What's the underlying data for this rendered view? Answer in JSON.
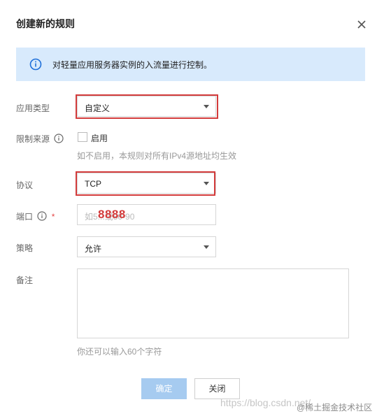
{
  "dialog": {
    "title": "创建新的规则",
    "info_text": "对轻量应用服务器实例的入流量进行控制。"
  },
  "fields": {
    "app_type": {
      "label": "应用类型",
      "value": "自定义"
    },
    "source": {
      "label": "限制来源",
      "checkbox_label": "启用",
      "hint": "如不启用，本规则对所有IPv4源地址均生效"
    },
    "protocol": {
      "label": "协议",
      "value": "TCP"
    },
    "port": {
      "label": "端口",
      "required_mark": "*",
      "placeholder": "如5...或80-90",
      "overlay_value": "8888"
    },
    "policy": {
      "label": "策略",
      "value": "允许"
    },
    "remark": {
      "label": "备注",
      "hint": "你还可以输入60个字符"
    }
  },
  "buttons": {
    "confirm": "确定",
    "close": "关闭"
  },
  "watermarks": {
    "url": "https://blog.csdn.net/",
    "brand": "@稀土掘金技术社区"
  },
  "colors": {
    "info_bg": "#d8eafc",
    "info_icon": "#1e6fd9",
    "highlight": "#d33b3b",
    "primary_disabled": "#a6cbf0"
  }
}
